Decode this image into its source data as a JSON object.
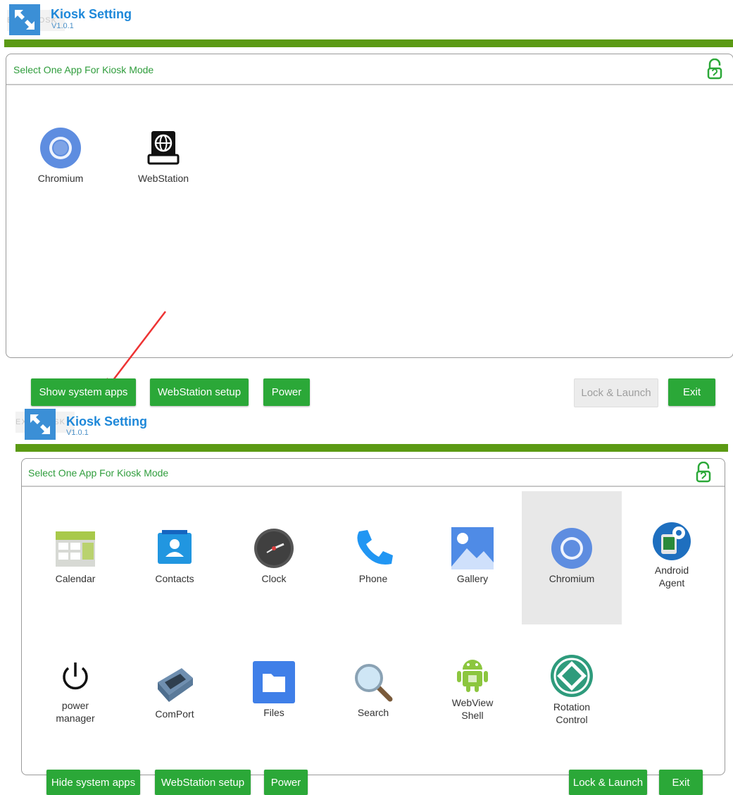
{
  "colors": {
    "accent": "#2ba838",
    "bar": "#5b9a14",
    "title": "#1e88d9",
    "disabled": "#ececec"
  },
  "screen1": {
    "ghost": "EXIT KIOSK",
    "app_title": "Kiosk Setting",
    "version": "V1.0.1",
    "panel_title": "Select One App For Kiosk Mode",
    "apps": [
      {
        "label": "Chromium",
        "icon": "chromium-icon"
      },
      {
        "label": "WebStation",
        "icon": "webstation-icon"
      }
    ],
    "buttons": {
      "show_system": "Show system apps",
      "webstation_setup": "WebStation setup",
      "power": "Power",
      "lock_launch": "Lock & Launch",
      "exit": "Exit"
    },
    "lock_launch_enabled": false
  },
  "screen2": {
    "ghost": "EXIT KIOSK",
    "app_title": "Kiosk Setting",
    "version": "V1.0.1",
    "panel_title": "Select One App For Kiosk Mode",
    "apps": [
      {
        "label": "Calendar",
        "icon": "calendar-icon"
      },
      {
        "label": "Contacts",
        "icon": "contacts-icon"
      },
      {
        "label": "Clock",
        "icon": "clock-icon"
      },
      {
        "label": "Phone",
        "icon": "phone-icon"
      },
      {
        "label": "Gallery",
        "icon": "gallery-icon"
      },
      {
        "label": "Chromium",
        "icon": "chromium-icon",
        "selected": true
      },
      {
        "label": "Android\nAgent",
        "icon": "android-agent-icon"
      },
      {
        "label": "power\nmanager",
        "icon": "power-icon"
      },
      {
        "label": "ComPort",
        "icon": "comport-icon"
      },
      {
        "label": "Files",
        "icon": "files-icon"
      },
      {
        "label": "Search",
        "icon": "search-icon"
      },
      {
        "label": "WebView\nShell",
        "icon": "android-icon"
      },
      {
        "label": "Rotation\nControl",
        "icon": "rotation-icon"
      }
    ],
    "buttons": {
      "hide_system": "Hide system apps",
      "webstation_setup": "WebStation setup",
      "power": "Power",
      "lock_launch": "Lock & Launch",
      "exit": "Exit"
    },
    "lock_launch_enabled": true
  }
}
